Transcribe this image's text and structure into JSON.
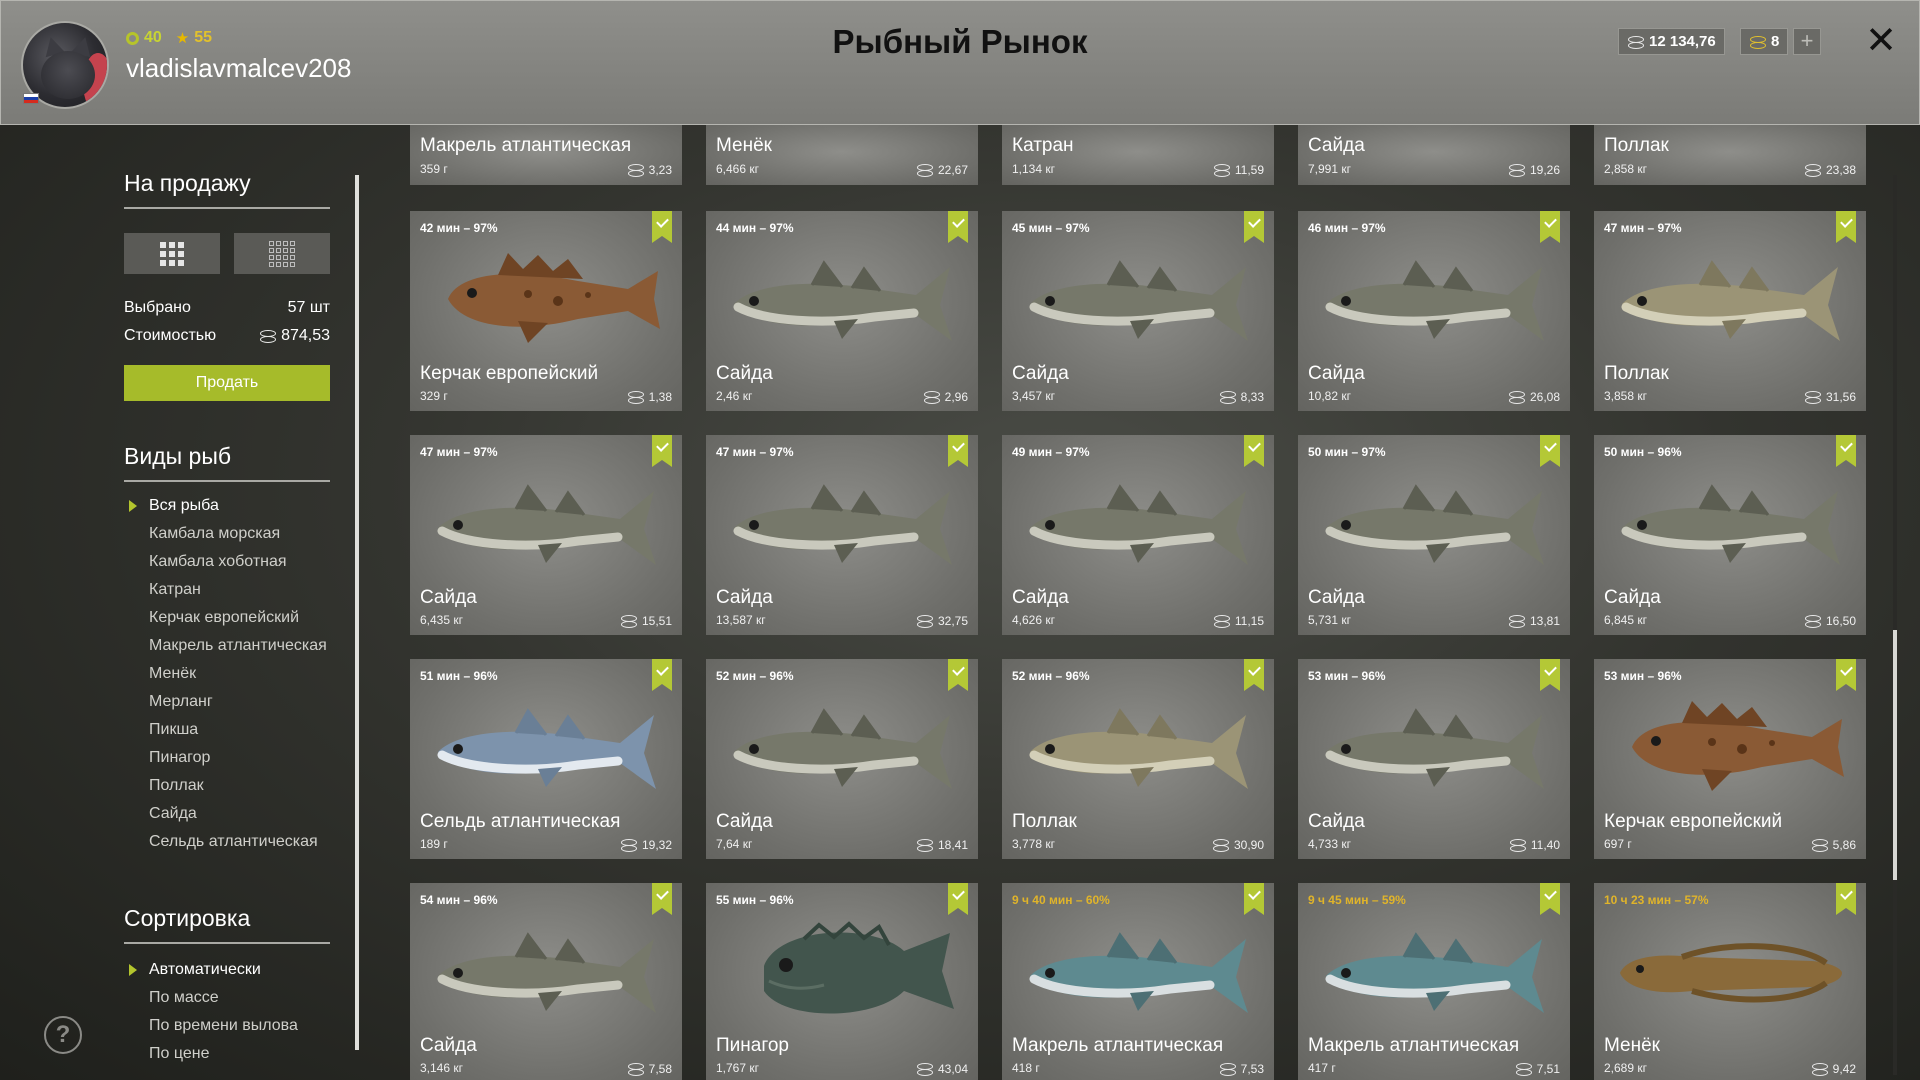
{
  "header": {
    "title": "Рыбный Рынок",
    "username": "vladislavmalcev208",
    "level": "40",
    "rank": "55",
    "silver": "12 134,76",
    "gold": "8",
    "add_label": "+",
    "close_label": "✕",
    "flag_colors": [
      "#ffffff",
      "#1c3fa8",
      "#d52b1e"
    ]
  },
  "sidebar": {
    "sale_title": "На продажу",
    "selected_label": "Выбрано",
    "selected_value": "57 шт",
    "cost_label": "Стоимостью",
    "cost_value": "874,53",
    "sell_button": "Продать",
    "kinds_title": "Виды рыб",
    "kinds": [
      "Вся рыба",
      "Камбала морская",
      "Камбала хоботная",
      "Катран",
      "Керчак европейский",
      "Макрель атлантическая",
      "Менёк",
      "Мерланг",
      "Пикша",
      "Пинагор",
      "Поллак",
      "Сайда",
      "Сельдь атлантическая"
    ],
    "sort_title": "Сортировка",
    "sort_options": [
      "Автоматически",
      "По массе",
      "По времени вылова",
      "По цене"
    ],
    "help_label": "?"
  },
  "top_row": [
    {
      "name": "Макрель атлантическая",
      "weight": "359 г",
      "price": "3,23"
    },
    {
      "name": "Менёк",
      "weight": "6,466 кг",
      "price": "22,67"
    },
    {
      "name": "Катран",
      "weight": "1,134 кг",
      "price": "11,59"
    },
    {
      "name": "Сайда",
      "weight": "7,991 кг",
      "price": "19,26"
    },
    {
      "name": "Поллак",
      "weight": "2,858 кг",
      "price": "23,38"
    }
  ],
  "cards": [
    {
      "time": "42 мин – 97%",
      "name": "Керчак европейский",
      "weight": "329 г",
      "price": "1,38",
      "fish": "sculpin",
      "warn": false
    },
    {
      "time": "44 мин – 97%",
      "name": "Сайда",
      "weight": "2,46 кг",
      "price": "2,96",
      "fish": "saithe",
      "warn": false
    },
    {
      "time": "45 мин – 97%",
      "name": "Сайда",
      "weight": "3,457 кг",
      "price": "8,33",
      "fish": "saithe",
      "warn": false
    },
    {
      "time": "46 мин – 97%",
      "name": "Сайда",
      "weight": "10,82 кг",
      "price": "26,08",
      "fish": "saithe",
      "warn": false
    },
    {
      "time": "47 мин – 97%",
      "name": "Поллак",
      "weight": "3,858 кг",
      "price": "31,56",
      "fish": "pollack",
      "warn": false
    },
    {
      "time": "47 мин – 97%",
      "name": "Сайда",
      "weight": "6,435 кг",
      "price": "15,51",
      "fish": "saithe",
      "warn": false
    },
    {
      "time": "47 мин – 97%",
      "name": "Сайда",
      "weight": "13,587 кг",
      "price": "32,75",
      "fish": "saithe",
      "warn": false
    },
    {
      "time": "49 мин – 97%",
      "name": "Сайда",
      "weight": "4,626 кг",
      "price": "11,15",
      "fish": "saithe",
      "warn": false
    },
    {
      "time": "50 мин – 97%",
      "name": "Сайда",
      "weight": "5,731 кг",
      "price": "13,81",
      "fish": "saithe",
      "warn": false
    },
    {
      "time": "50 мин – 96%",
      "name": "Сайда",
      "weight": "6,845 кг",
      "price": "16,50",
      "fish": "saithe",
      "warn": false
    },
    {
      "time": "51 мин – 96%",
      "name": "Сельдь атлантическая",
      "weight": "189 г",
      "price": "19,32",
      "fish": "herring",
      "warn": false
    },
    {
      "time": "52 мин – 96%",
      "name": "Сайда",
      "weight": "7,64 кг",
      "price": "18,41",
      "fish": "saithe",
      "warn": false
    },
    {
      "time": "52 мин – 96%",
      "name": "Поллак",
      "weight": "3,778 кг",
      "price": "30,90",
      "fish": "pollack",
      "warn": false
    },
    {
      "time": "53 мин – 96%",
      "name": "Сайда",
      "weight": "4,733 кг",
      "price": "11,40",
      "fish": "saithe",
      "warn": false
    },
    {
      "time": "53 мин – 96%",
      "name": "Керчак европейский",
      "weight": "697 г",
      "price": "5,86",
      "fish": "sculpin",
      "warn": false
    },
    {
      "time": "54 мин – 96%",
      "name": "Сайда",
      "weight": "3,146 кг",
      "price": "7,58",
      "fish": "saithe",
      "warn": false
    },
    {
      "time": "55 мин – 96%",
      "name": "Пинагор",
      "weight": "1,767 кг",
      "price": "43,04",
      "fish": "lumpfish",
      "warn": false
    },
    {
      "time": "9 ч 40 мин – 60%",
      "name": "Макрель атлантическая",
      "weight": "418 г",
      "price": "7,53",
      "fish": "mackerel",
      "warn": true
    },
    {
      "time": "9 ч 45 мин – 59%",
      "name": "Макрель атлантическая",
      "weight": "417 г",
      "price": "7,51",
      "fish": "mackerel",
      "warn": true
    },
    {
      "time": "10 ч 23 мин – 57%",
      "name": "Менёк",
      "weight": "2,689 кг",
      "price": "9,42",
      "fish": "tusk",
      "warn": true
    }
  ],
  "colors": {
    "accent": "#a6bb2a",
    "check": "#b4c836",
    "warn_time": "#e0b42a"
  }
}
